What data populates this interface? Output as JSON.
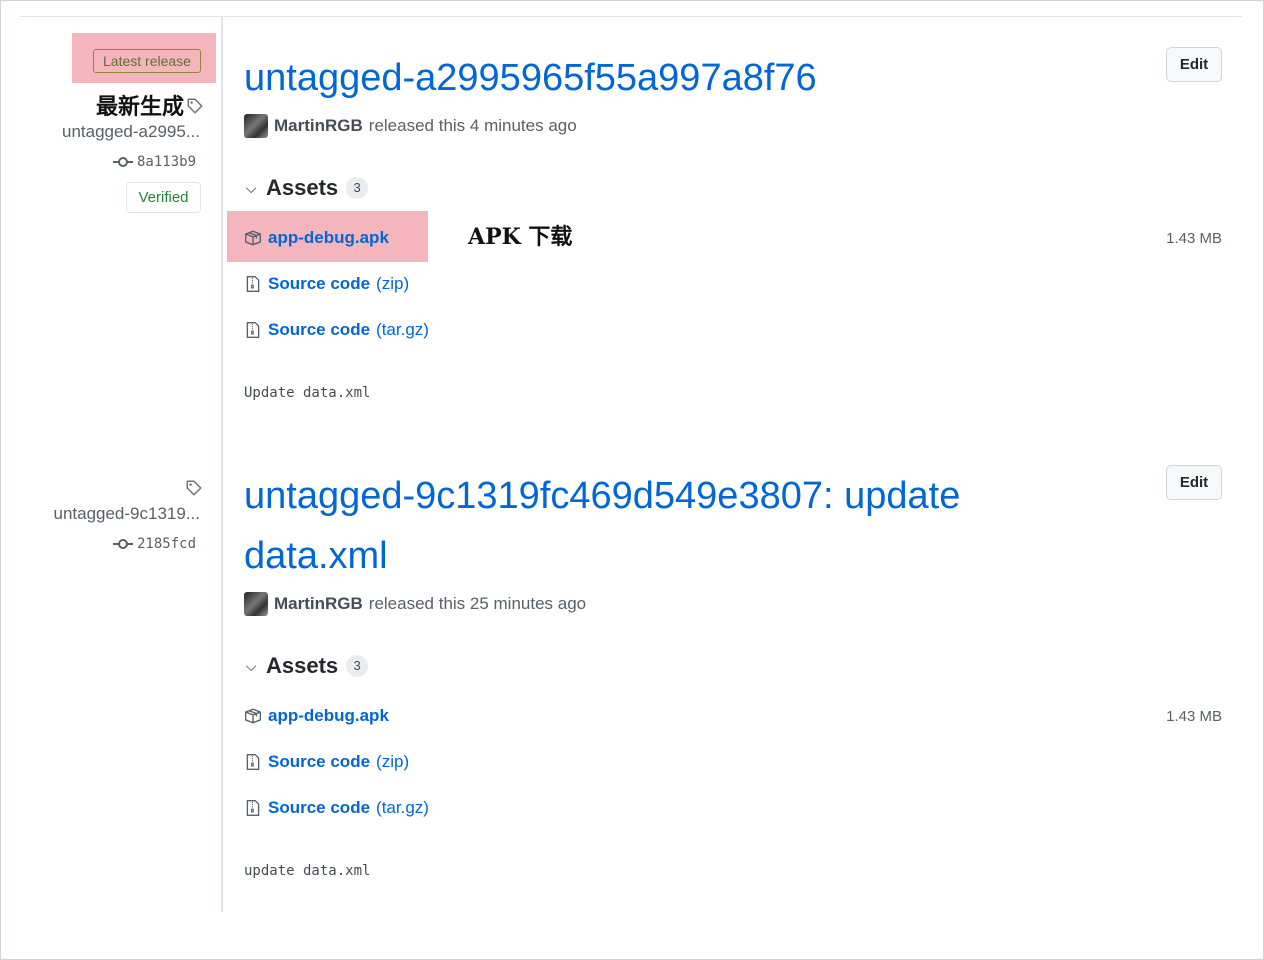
{
  "annotations": {
    "latest_note": "最新生成",
    "apk_note": "APK 下载"
  },
  "releases": [
    {
      "latest_label": "Latest release",
      "tag": "untagged-a2995...",
      "commit": "8a113b9",
      "verified": "Verified",
      "title": "untagged-a2995965f55a997a8f76",
      "edit": "Edit",
      "author": "MartinRGB",
      "released": "released this 4 minutes ago",
      "assets_label": "Assets",
      "assets_count": "3",
      "assets": [
        {
          "name": "app-debug.apk",
          "ext": "",
          "size": "1.43 MB",
          "icon": "package-icon"
        },
        {
          "name": "Source code",
          "ext": "(zip)",
          "size": "",
          "icon": "file-zip-icon"
        },
        {
          "name": "Source code",
          "ext": "(tar.gz)",
          "size": "",
          "icon": "file-zip-icon"
        }
      ],
      "notes": "Update data.xml"
    },
    {
      "tag": "untagged-9c1319...",
      "commit": "2185fcd",
      "title": "untagged-9c1319fc469d549e3807: update data.xml",
      "edit": "Edit",
      "author": "MartinRGB",
      "released": "released this 25 minutes ago",
      "assets_label": "Assets",
      "assets_count": "3",
      "assets": [
        {
          "name": "app-debug.apk",
          "ext": "",
          "size": "1.43 MB",
          "icon": "package-icon"
        },
        {
          "name": "Source code",
          "ext": "(zip)",
          "size": "",
          "icon": "file-zip-icon"
        },
        {
          "name": "Source code",
          "ext": "(tar.gz)",
          "size": "",
          "icon": "file-zip-icon"
        }
      ],
      "notes": "update data.xml"
    }
  ],
  "colors": {
    "link": "#0366d6",
    "highlight": "#f4b5bd",
    "verified": "#22863a"
  }
}
